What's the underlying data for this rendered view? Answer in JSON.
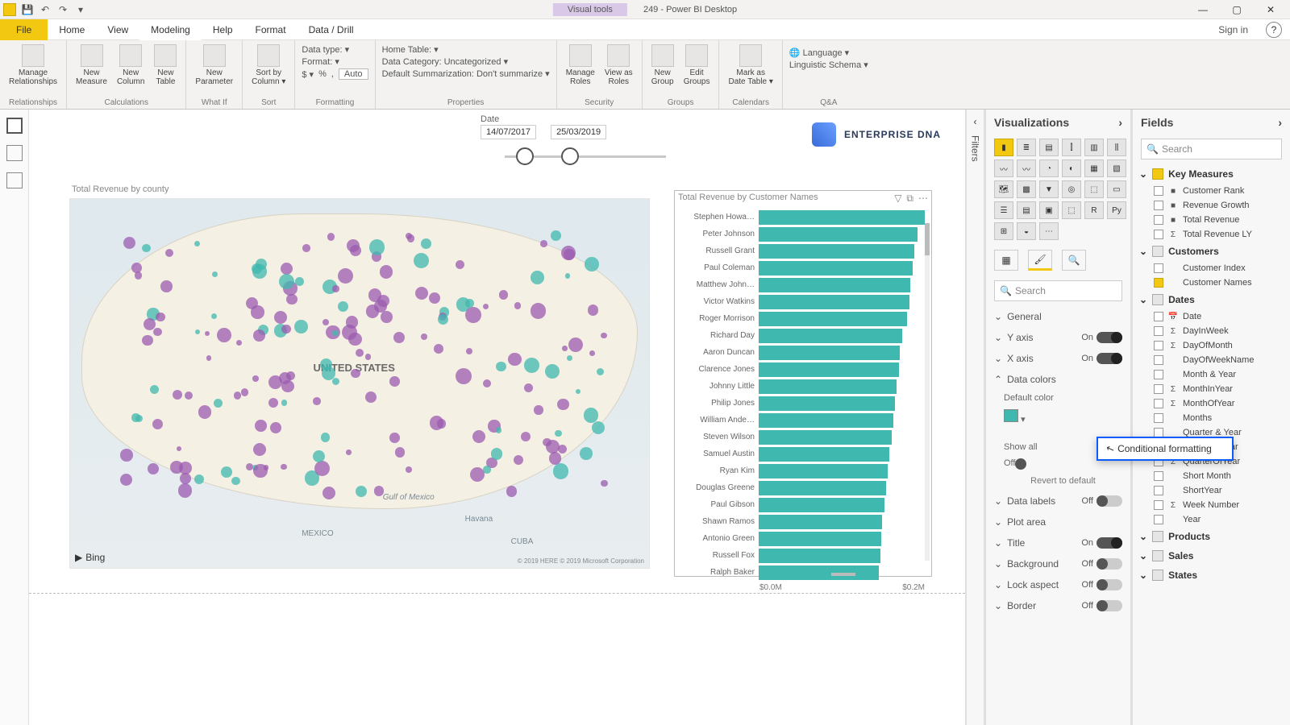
{
  "qat_icons": [
    "save-icon",
    "undo-icon",
    "redo-icon"
  ],
  "title": {
    "visual_tools": "Visual tools",
    "app_title": "249 - Power BI Desktop"
  },
  "win": {
    "min": "—",
    "max": "▢",
    "close": "✕"
  },
  "menu": {
    "file": "File",
    "items": [
      "Home",
      "View",
      "Modeling",
      "Help",
      "Format",
      "Data / Drill"
    ],
    "signin": "Sign in"
  },
  "ribbon": {
    "relationships": {
      "btn": "Manage\nRelationships",
      "group": "Relationships"
    },
    "calculations": {
      "btns": [
        "New\nMeasure",
        "New\nColumn",
        "New\nTable"
      ],
      "group": "Calculations"
    },
    "whatif": {
      "btn": "New\nParameter",
      "group": "What If"
    },
    "sort": {
      "btn": "Sort by\nColumn ▾",
      "group": "Sort"
    },
    "formatting": {
      "data_type": "Data type:  ▾",
      "format": "Format:  ▾",
      "currency": "$ ▾",
      "pct": "%",
      "comma": ",",
      "auto": "Auto",
      "group": "Formatting"
    },
    "properties": {
      "home": "Home Table:  ▾",
      "cat": "Data Category: Uncategorized ▾",
      "summ": "Default Summarization: Don't summarize ▾",
      "group": "Properties"
    },
    "security": {
      "btns": [
        "Manage\nRoles",
        "View as\nRoles"
      ],
      "group": "Security"
    },
    "groups": {
      "btns": [
        "New\nGroup",
        "Edit\nGroups"
      ],
      "group": "Groups"
    },
    "calendars": {
      "btn": "Mark as\nDate Table ▾",
      "group": "Calendars"
    },
    "qa": {
      "lang": "🌐 Language ▾",
      "schema": "Linguistic Schema ▾",
      "group": "Q&A"
    }
  },
  "filters_tab": "Filters",
  "visualizations": {
    "header": "Visualizations",
    "search_ph": "Search",
    "sections": [
      {
        "name": "General",
        "toggle": null,
        "expanded": false
      },
      {
        "name": "Y axis",
        "toggle": "On",
        "expanded": false
      },
      {
        "name": "X axis",
        "toggle": "On",
        "expanded": false
      },
      {
        "name": "Data colors",
        "toggle": null,
        "expanded": true,
        "children": {
          "default_color": "Default color",
          "show_all": "Show all",
          "show_all_state": "Off",
          "revert": "Revert to default"
        }
      },
      {
        "name": "Data labels",
        "toggle": "Off",
        "expanded": false
      },
      {
        "name": "Plot area",
        "toggle": null,
        "expanded": false
      },
      {
        "name": "Title",
        "toggle": "On",
        "expanded": false
      },
      {
        "name": "Background",
        "toggle": "Off",
        "expanded": false
      },
      {
        "name": "Lock aspect",
        "toggle": "Off",
        "expanded": false
      },
      {
        "name": "Border",
        "toggle": "Off",
        "expanded": false
      }
    ]
  },
  "fields": {
    "header": "Fields",
    "search_ph": "Search",
    "tables": [
      {
        "name": "Key Measures",
        "icon": "measure",
        "items": [
          {
            "name": "Customer Rank",
            "sig": "■"
          },
          {
            "name": "Revenue Growth",
            "sig": "■"
          },
          {
            "name": "Total Revenue",
            "sig": "■"
          },
          {
            "name": "Total Revenue LY",
            "sig": "Σ"
          }
        ]
      },
      {
        "name": "Customers",
        "icon": "table",
        "items": [
          {
            "name": "Customer Index",
            "sig": ""
          },
          {
            "name": "Customer Names",
            "sig": "",
            "checked": true
          }
        ]
      },
      {
        "name": "Dates",
        "icon": "table",
        "expanded": true,
        "items": [
          {
            "name": "Date",
            "sig": "📅"
          },
          {
            "name": "DayInWeek",
            "sig": "Σ"
          },
          {
            "name": "DayOfMonth",
            "sig": "Σ"
          },
          {
            "name": "DayOfWeekName",
            "sig": ""
          },
          {
            "name": "Month & Year",
            "sig": ""
          },
          {
            "name": "MonthInYear",
            "sig": "Σ"
          },
          {
            "name": "MonthOfYear",
            "sig": "Σ"
          },
          {
            "name": "Months",
            "sig": ""
          },
          {
            "name": "Quarter & Year",
            "sig": ""
          },
          {
            "name": "QuarterInYear",
            "sig": "Σ"
          },
          {
            "name": "QuarterOfYear",
            "sig": "Σ"
          },
          {
            "name": "Short Month",
            "sig": ""
          },
          {
            "name": "ShortYear",
            "sig": ""
          },
          {
            "name": "Week Number",
            "sig": "Σ"
          },
          {
            "name": "Year",
            "sig": ""
          }
        ]
      },
      {
        "name": "Products",
        "icon": "table"
      },
      {
        "name": "Sales",
        "icon": "table"
      },
      {
        "name": "States",
        "icon": "table"
      }
    ]
  },
  "context_menu": {
    "item": "Conditional formatting"
  },
  "slicer": {
    "label": "Date",
    "from": "14/07/2017",
    "to": "25/03/2019"
  },
  "logo": "ENTERPRISE DNA",
  "map": {
    "title": "Total Revenue by county",
    "country": "UNITED STATES",
    "mexico": "MEXICO",
    "cuba": "CUBA",
    "gulf": "Gulf of Mexico",
    "havana": "Havana",
    "bing": "Bing",
    "attrib": "© 2019 HERE © 2019 Microsoft Corporation"
  },
  "chart_data": {
    "type": "bar",
    "title": "Total Revenue by Customer Names",
    "xlabel": "",
    "ylabel": "",
    "xlim": [
      0,
      0.25
    ],
    "x_ticks": [
      "$0.0M",
      "$0.2M"
    ],
    "categories": [
      "Stephen Howa…",
      "Peter Johnson",
      "Russell Grant",
      "Paul Coleman",
      "Matthew John…",
      "Victor Watkins",
      "Roger Morrison",
      "Richard Day",
      "Aaron Duncan",
      "Clarence Jones",
      "Johnny Little",
      "Philip Jones",
      "William Ande…",
      "Steven Wilson",
      "Samuel Austin",
      "Ryan Kim",
      "Douglas Greene",
      "Paul Gibson",
      "Shawn Ramos",
      "Antonio Green",
      "Russell Fox",
      "Ralph Baker"
    ],
    "values": [
      0.235,
      0.225,
      0.22,
      0.218,
      0.215,
      0.213,
      0.21,
      0.203,
      0.2,
      0.198,
      0.195,
      0.193,
      0.19,
      0.188,
      0.185,
      0.183,
      0.18,
      0.178,
      0.175,
      0.173,
      0.172,
      0.17
    ]
  }
}
